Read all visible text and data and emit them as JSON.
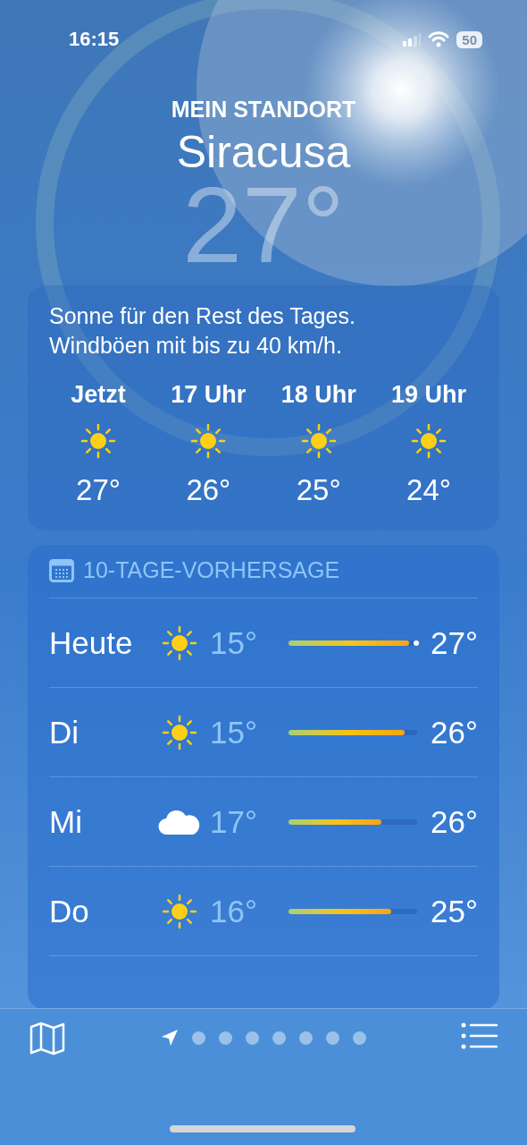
{
  "status_bar": {
    "time": "16:15",
    "battery": "50"
  },
  "header": {
    "subtitle": "MEIN STANDORT",
    "city": "Siracusa",
    "temperature": "27°"
  },
  "hourly": {
    "summary": "Sonne für den Rest des Tages. Windböen mit bis zu 40 km/h.",
    "hours": [
      {
        "label": "Jetzt",
        "kind": "sun",
        "temp": "27°"
      },
      {
        "label": "17 Uhr",
        "kind": "sun",
        "temp": "26°"
      },
      {
        "label": "18 Uhr",
        "kind": "sun",
        "temp": "25°"
      },
      {
        "label": "19 Uhr",
        "kind": "sun",
        "temp": "24°"
      }
    ]
  },
  "forecast": {
    "title": "10-TAGE-VORHERSAGE",
    "days": [
      {
        "day": "Heute",
        "kind": "sun",
        "low": "15°",
        "high": "27°",
        "level": 0.94,
        "now_marker": true
      },
      {
        "day": "Di",
        "kind": "sun",
        "low": "15°",
        "high": "26°",
        "level": 0.9,
        "now_marker": false
      },
      {
        "day": "Mi",
        "kind": "cloud",
        "low": "17°",
        "high": "26°",
        "level": 0.72,
        "now_marker": false
      },
      {
        "day": "Do",
        "kind": "sun",
        "low": "16°",
        "high": "25°",
        "level": 0.8,
        "now_marker": false
      }
    ]
  },
  "pages": [
    {
      "kind": "location",
      "selected": true
    },
    {
      "kind": "dot",
      "selected": false
    },
    {
      "kind": "dot",
      "selected": false
    },
    {
      "kind": "dot",
      "selected": false
    },
    {
      "kind": "dot",
      "selected": false
    },
    {
      "kind": "dot",
      "selected": false
    },
    {
      "kind": "dot",
      "selected": false
    },
    {
      "kind": "dot",
      "selected": false
    }
  ]
}
